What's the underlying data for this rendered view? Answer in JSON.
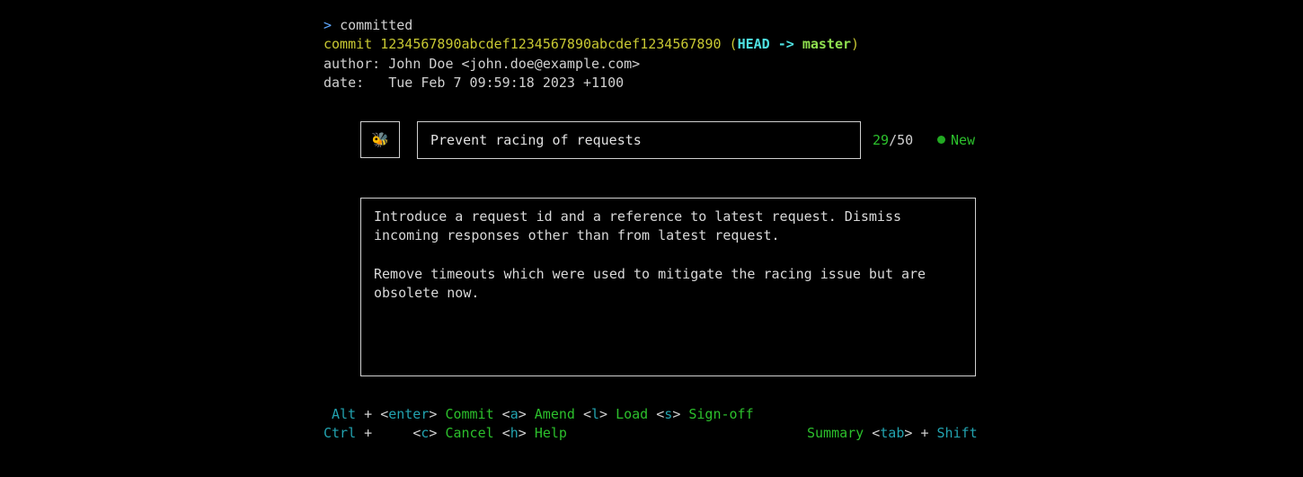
{
  "terminal": {
    "prompt_mark": ">",
    "prompt_text": "committed",
    "commit_label": "commit",
    "commit_hash": "1234567890abcdef1234567890abcdef1234567890",
    "ref_open": "(",
    "ref_head": "HEAD",
    "ref_arrow": "->",
    "ref_branch": "master",
    "ref_close": ")",
    "author_line": "author: John Doe <john.doe@example.com>",
    "date_line": "date:   Tue Feb 7 09:59:18 2023 +1100"
  },
  "editor": {
    "emoji": "🐝",
    "summary_value": "Prevent racing of requests",
    "count_current": "29",
    "count_sep": "/",
    "count_max": "50",
    "status_label": "New",
    "body_lines": [
      "Introduce a request id and a reference to latest request. Dismiss",
      "incoming responses other than from latest request.",
      "",
      "Remove timeouts which were used to mitigate the racing issue but are",
      "obsolete now."
    ]
  },
  "hints": {
    "mod_alt": "Alt",
    "mod_ctrl": "Ctrl",
    "plus": "+",
    "enter_key": "enter",
    "commit_action": "Commit",
    "a_key": "a",
    "amend_action": "Amend",
    "l_key": "l",
    "load_action": "Load",
    "s_key": "s",
    "signoff_action": "Sign-off",
    "c_key": "c",
    "cancel_action": "Cancel",
    "h_key": "h",
    "help_action": "Help",
    "summary_action": "Summary",
    "tab_key": "tab",
    "shift_mod": "Shift"
  },
  "colors": {
    "background": "#000000",
    "prompt_mark": "#5fa8ff",
    "commit_hash": "#c8c832",
    "head_ref": "#4ee0e0",
    "branch": "#8fe04f",
    "accent_green": "#2cc02c",
    "accent_teal": "#22a3b0"
  }
}
